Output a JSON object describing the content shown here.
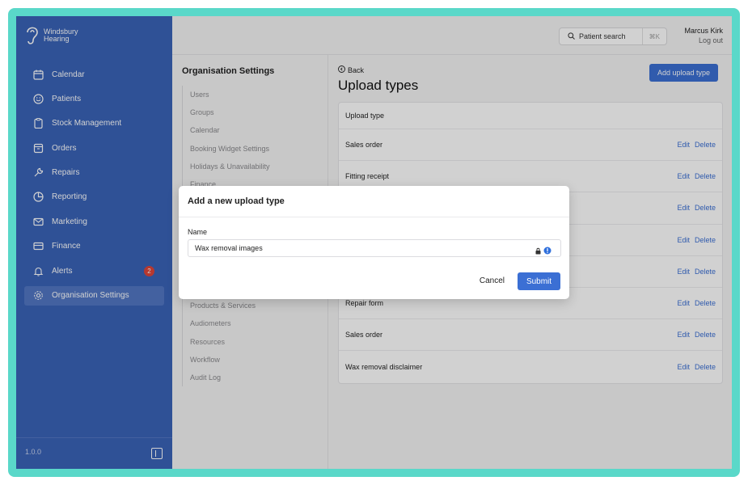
{
  "brand": {
    "name_line1": "Windsbury",
    "name_line2": "Hearing"
  },
  "sidebar": {
    "items": [
      {
        "label": "Calendar",
        "icon": "calendar-icon"
      },
      {
        "label": "Patients",
        "icon": "smile-icon"
      },
      {
        "label": "Stock Management",
        "icon": "clipboard-icon"
      },
      {
        "label": "Orders",
        "icon": "box-icon"
      },
      {
        "label": "Repairs",
        "icon": "wrench-icon"
      },
      {
        "label": "Reporting",
        "icon": "pie-chart-icon"
      },
      {
        "label": "Marketing",
        "icon": "mail-icon"
      },
      {
        "label": "Finance",
        "icon": "card-icon"
      },
      {
        "label": "Alerts",
        "icon": "bell-icon",
        "badge": "2"
      },
      {
        "label": "Organisation Settings",
        "icon": "gear-icon",
        "active": true
      }
    ],
    "version": "1.0.0"
  },
  "topbar": {
    "search_label": "Patient search",
    "search_shortcut": "⌘K",
    "user_name": "Marcus Kirk",
    "logout_label": "Log out"
  },
  "settings": {
    "title": "Organisation Settings",
    "items_top": [
      "Users",
      "Groups",
      "Calendar",
      "Booking Widget Settings",
      "Holidays & Unavailability",
      "Finance"
    ],
    "items_bottom": [
      "Products & Services",
      "Audiometers",
      "Resources",
      "Workflow",
      "Audit Log"
    ]
  },
  "main": {
    "back_label": "Back",
    "title": "Upload types",
    "add_button": "Add upload type",
    "table_header": "Upload type",
    "edit_label": "Edit",
    "delete_label": "Delete",
    "rows": [
      "Sales order",
      "Fitting receipt",
      "",
      "",
      "",
      "Repair form",
      "Sales order",
      "Wax removal disclaimer"
    ]
  },
  "modal": {
    "title": "Add a new upload type",
    "field_label": "Name",
    "field_value": "Wax removal images",
    "cancel_label": "Cancel",
    "submit_label": "Submit"
  },
  "colors": {
    "sidebar_bg": "#3a63b8",
    "accent": "#3b6fd4",
    "frame": "#5ad8c9",
    "badge": "#e0453a"
  }
}
